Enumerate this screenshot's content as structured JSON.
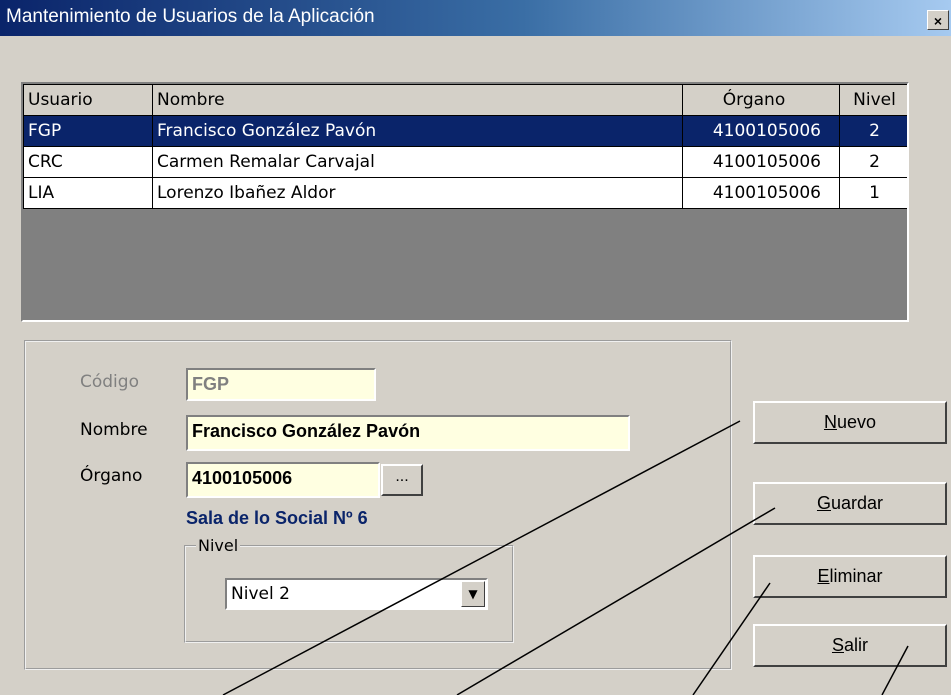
{
  "window": {
    "title": "Mantenimiento de Usuarios de la Aplicación",
    "close_glyph": "×"
  },
  "grid": {
    "columns": [
      "Usuario",
      "Nombre",
      "Órgano",
      "Nivel"
    ],
    "rows": [
      {
        "usuario": "FGP",
        "nombre": "Francisco González Pavón",
        "organo": "4100105006",
        "nivel": "2",
        "selected": true
      },
      {
        "usuario": "CRC",
        "nombre": "Carmen Remalar Carvajal",
        "organo": "4100105006",
        "nivel": "2",
        "selected": false
      },
      {
        "usuario": "LIA",
        "nombre": "Lorenzo Ibañez Aldor",
        "organo": "4100105006",
        "nivel": "1",
        "selected": false
      }
    ]
  },
  "form": {
    "codigo_label": "Código",
    "codigo_value": "FGP",
    "nombre_label": "Nombre",
    "nombre_value": "Francisco González Pavón",
    "organo_label": "Órgano",
    "organo_value": "4100105006",
    "browse_label": "...",
    "organo_desc": "Sala de lo Social Nº 6",
    "nivel_legend": "Nivel",
    "nivel_value": "Nivel  2"
  },
  "buttons": {
    "nuevo": {
      "accel": "N",
      "rest": "uevo"
    },
    "guardar": {
      "accel": "G",
      "rest": "uardar"
    },
    "eliminar": {
      "accel": "E",
      "rest": "liminar"
    },
    "salir": {
      "accel": "S",
      "rest": "alir"
    }
  },
  "colors": {
    "face": "#d4d0c8",
    "selection": "#0a246a",
    "field_bg": "#ffffe1",
    "title_start": "#0a246a"
  }
}
